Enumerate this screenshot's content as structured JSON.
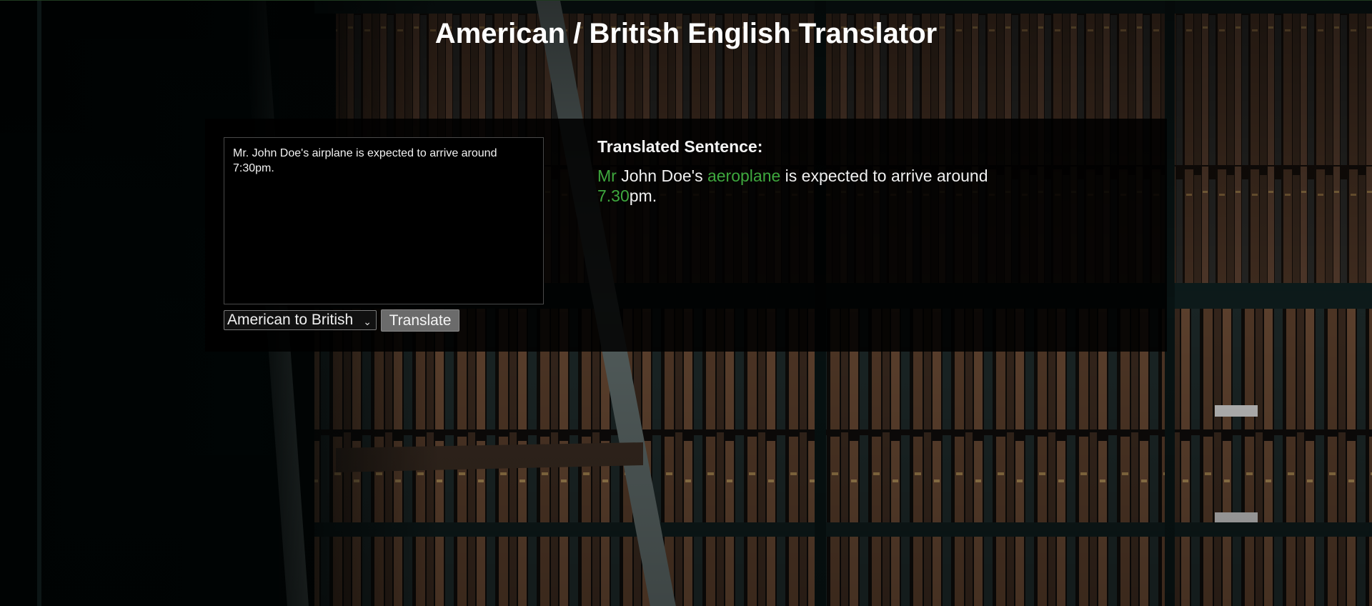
{
  "page": {
    "title": "American / British English Translator"
  },
  "input": {
    "text": "Mr. John Doe's airplane is expected to arrive around 7:30pm."
  },
  "locale_select": {
    "selected": "American to British",
    "icon": "chevron-down-icon"
  },
  "translate_button": {
    "label": "Translate"
  },
  "output": {
    "heading": "Translated Sentence:",
    "segments": [
      {
        "text": "Mr",
        "highlight": true
      },
      {
        "text": " John Doe's ",
        "highlight": false
      },
      {
        "text": "aeroplane",
        "highlight": true
      },
      {
        "text": " is expected to arrive around ",
        "highlight": false
      },
      {
        "text": "7.30",
        "highlight": true
      },
      {
        "text": "pm.",
        "highlight": false
      }
    ]
  },
  "colors": {
    "highlight": "#3ea83e",
    "panel_bg": "#000000",
    "button_bg": "#6b6b6b",
    "text": "#f0f0f0"
  }
}
